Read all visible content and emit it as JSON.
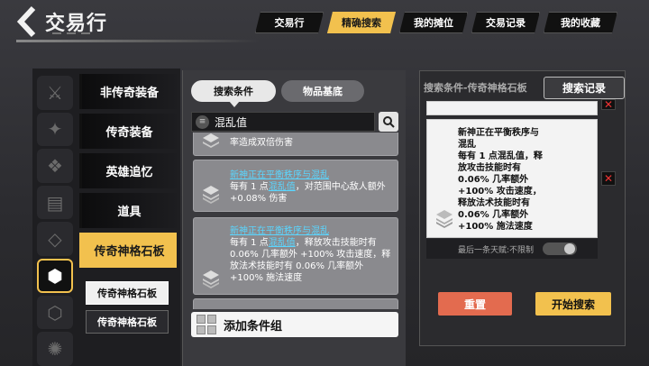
{
  "header": {
    "title": "交易行",
    "tabs": [
      "交易行",
      "精确搜索",
      "我的摊位",
      "交易记录",
      "我的收藏"
    ],
    "active_tab": "精确搜索"
  },
  "categories": {
    "items": [
      "非传奇装备",
      "传奇装备",
      "英雄追忆",
      "道具",
      "传奇神格石板"
    ],
    "active": "传奇神格石板",
    "sub_items": [
      "传奇神格石板",
      "传奇神格石板"
    ]
  },
  "middle": {
    "segments": [
      "搜索条件",
      "物品基底"
    ],
    "search_value": "混乱值",
    "cards": [
      {
        "title": "",
        "text_before": "",
        "highlight": "",
        "text_after": "率造成双倍伤害"
      },
      {
        "title": "新神正在平衡秩序与混乱",
        "text_before": "每有 1 点",
        "highlight": "混乱值",
        "text_after": "，对范围中心敌人额外 +0.08% 伤害"
      },
      {
        "title": "新神正在平衡秩序与混乱",
        "text_before": "每有 1 点",
        "highlight": "混乱值",
        "text_after": "，释放攻击技能时有 0.06% 几率额外 +100% 攻击速度，释放法术技能时有 0.06% 几率额外 +100% 施法速度"
      }
    ],
    "add_group_label": "添加条件组"
  },
  "right": {
    "title": "搜索条件-传奇神格石板",
    "history_label": "搜索记录",
    "condition_text": "新神正在平衡秩序与\n混乱\n每有 1 点混乱值，释\n放攻击技能时有\n0.06% 几率额外\n+100% 攻击速度，\n释放法术技能时有\n0.06% 几率额外\n+100% 施法速度",
    "last_row_label": "最后一条天赋:不限制",
    "reset_label": "重置",
    "start_label": "开始搜索"
  },
  "colors": {
    "accent": "#f2c14e",
    "link": "#5ad6ff",
    "danger": "#e36b4f"
  },
  "icons": {
    "back": "chevron-left-icon",
    "search": "magnifier-icon",
    "remove": "close-icon"
  }
}
